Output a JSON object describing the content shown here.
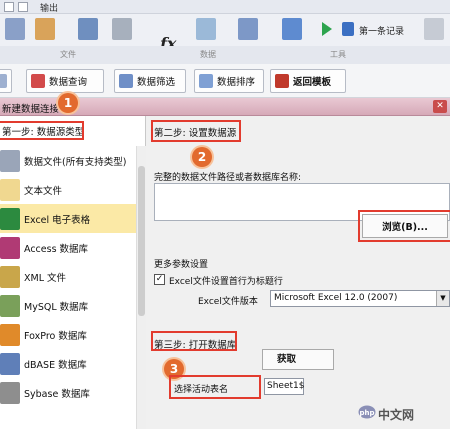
{
  "ribbon": {
    "quick_label": "输出",
    "first_record": "第一条记录",
    "formula_glyph": "fx",
    "lower_labels": [
      "文件",
      "数据",
      "工具"
    ],
    "colors": {
      "accent_green": "#2da44e",
      "accent_blue": "#3b6fc2"
    }
  },
  "toolbar": {
    "buttons": [
      {
        "label": "",
        "icon": "partial-icon"
      },
      {
        "label": "数据查询",
        "icon": "query-icon"
      },
      {
        "label": "数据筛选",
        "icon": "filter-icon"
      },
      {
        "label": "数据排序",
        "icon": "sort-icon"
      },
      {
        "label": "返回模板",
        "icon": "back-template-icon"
      }
    ]
  },
  "dialog": {
    "title": "新建数据连接",
    "step1": {
      "title": "第一步: 数据源类型",
      "items": [
        {
          "label": "数据文件(所有支持类型)",
          "icon": "data-file-icon",
          "color": "#9aa5b8"
        },
        {
          "label": "文本文件",
          "icon": "text-file-icon",
          "color": "#f0d890"
        },
        {
          "label": "Excel 电子表格",
          "icon": "excel-icon",
          "color": "#2c8a3f",
          "selected": true
        },
        {
          "label": "Access 数据库",
          "icon": "access-icon",
          "color": "#b03a74"
        },
        {
          "label": "XML 文件",
          "icon": "xml-file-icon",
          "color": "#c9a64a"
        },
        {
          "label": "MySQL 数据库",
          "icon": "mysql-icon",
          "color": "#7aa05a"
        },
        {
          "label": "FoxPro 数据库",
          "icon": "foxpro-icon",
          "color": "#e08a2a"
        },
        {
          "label": "dBASE 数据库",
          "icon": "dbase-icon",
          "color": "#5f7fb8"
        },
        {
          "label": "Sybase 数据库",
          "icon": "sybase-icon",
          "color": "#8e8e8e"
        }
      ]
    },
    "step2": {
      "title": "第二步: 设置数据源",
      "path_label": "完整的数据文件路径或者数据库名称:",
      "path_value": "",
      "browse_label": "浏览(B)...",
      "more_label": "更多参数设置",
      "header_checkbox_label": "Excel文件设置首行为标题行",
      "header_checked": true,
      "version_label": "Excel文件版本",
      "version_value": "Microsoft Excel 12.0 (2007)"
    },
    "step3": {
      "title": "第三步: 打开数据库",
      "fetch_label": "获取",
      "sheet_label": "选择活动表名",
      "sheet_value": "Sheet1$"
    },
    "markers": [
      "1",
      "2",
      "3"
    ]
  },
  "watermark": {
    "text": "中文网"
  },
  "colors": {
    "highlight": "#e23b2e",
    "marker": "#e26a2e",
    "selection": "#fbe9a6"
  }
}
